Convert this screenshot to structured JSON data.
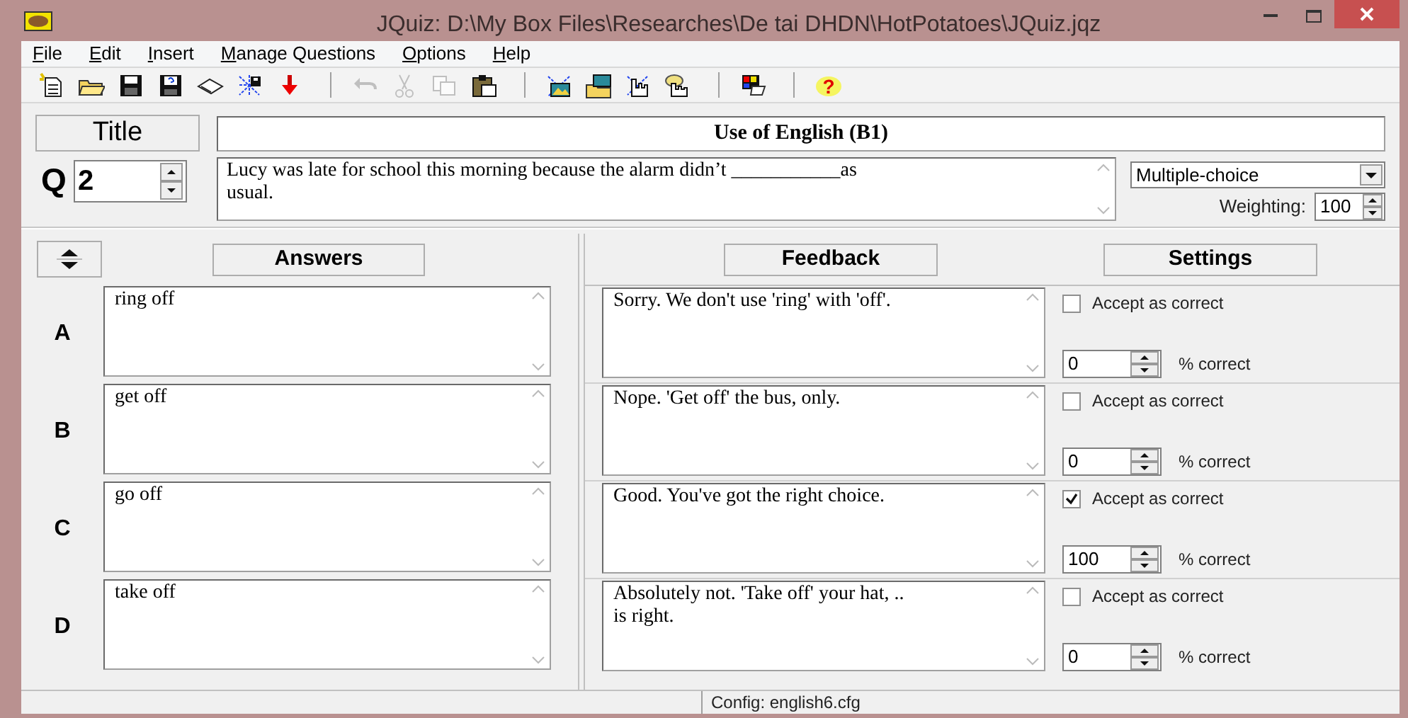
{
  "window": {
    "title": "JQuiz: D:\\My Box Files\\Researches\\De tai DHDN\\HotPotatoes\\JQuiz.jqz"
  },
  "menu": [
    {
      "label": "File"
    },
    {
      "label": "Edit"
    },
    {
      "label": "Insert"
    },
    {
      "label": "Manage Questions"
    },
    {
      "label": "Options"
    },
    {
      "label": "Help"
    }
  ],
  "toolbar": [
    [
      {
        "kind": "new",
        "disabled": false
      },
      {
        "kind": "open",
        "disabled": false
      },
      {
        "kind": "save",
        "disabled": false
      },
      {
        "kind": "saveas",
        "disabled": false
      },
      {
        "kind": "book",
        "disabled": false
      },
      {
        "kind": "web",
        "disabled": false
      },
      {
        "kind": "down",
        "disabled": false
      }
    ],
    [
      {
        "kind": "undo",
        "disabled": true
      },
      {
        "kind": "cut",
        "disabled": true
      },
      {
        "kind": "copy",
        "disabled": true
      },
      {
        "kind": "paste",
        "disabled": false
      }
    ],
    [
      {
        "kind": "webpic",
        "disabled": false
      },
      {
        "kind": "folderpic",
        "disabled": false
      },
      {
        "kind": "webhand",
        "disabled": false
      },
      {
        "kind": "hand",
        "disabled": false
      }
    ],
    [
      {
        "kind": "config",
        "disabled": false
      }
    ],
    [
      {
        "kind": "help",
        "disabled": false,
        "glyph": "?"
      }
    ]
  ],
  "title_button": "Title",
  "title_value": "Use of English (B1)",
  "question": {
    "label": "Q",
    "number": "2",
    "text": "Lucy was late for school this morning because the alarm didn’t ___________as usual.",
    "type": "Multiple-choice",
    "weighting_label": "Weighting:",
    "weighting": "100"
  },
  "headers": {
    "answers": "Answers",
    "feedback": "Feedback",
    "settings": "Settings"
  },
  "rows": [
    {
      "letter": "A",
      "answer": "ring off",
      "feedback": "Sorry. We don't use 'ring' with 'off'.",
      "accept_label": "Accept as correct",
      "checked": false,
      "percent": "0",
      "percent_label": "% correct"
    },
    {
      "letter": "B",
      "answer": "get off",
      "feedback": "Nope. 'Get off' the bus, only.",
      "accept_label": "Accept as correct",
      "checked": false,
      "percent": "0",
      "percent_label": "% correct"
    },
    {
      "letter": "C",
      "answer": "go off",
      "feedback": "Good. You've got the right choice.",
      "accept_label": "Accept as correct",
      "checked": true,
      "percent": "100",
      "percent_label": "% correct"
    },
    {
      "letter": "D",
      "answer": "take off",
      "feedback": "Absolutely not. 'Take off' your hat, .. is right.",
      "accept_label": "Accept as correct",
      "checked": false,
      "percent": "0",
      "percent_label": "% correct"
    }
  ],
  "status_bar": "Config: english6.cfg"
}
